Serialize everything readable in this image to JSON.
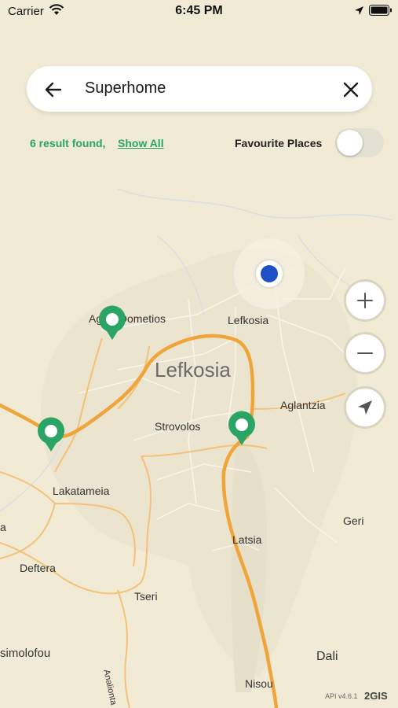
{
  "status_bar": {
    "carrier": "Carrier",
    "time": "6:45 PM"
  },
  "search": {
    "query": "Superhome"
  },
  "results": {
    "count_text": "6 result found,",
    "show_all_label": "Show All"
  },
  "favourites": {
    "label": "Favourite Places",
    "enabled": false
  },
  "map": {
    "labels": {
      "agios_dometios": "Agios Dometios",
      "lefkosia": "Lefkosia",
      "lefkosia_big": "Lefkosia",
      "aglantzia": "Aglantzia",
      "strovolos": "Strovolos",
      "lakatameia": "Lakatameia",
      "geri": "Geri",
      "latsia": "Latsia",
      "deftera": "Deftera",
      "tseri": "Tseri",
      "psimolofou": "simolofou",
      "analionta": "Analionta",
      "dali": "Dali",
      "nisou": "Nisou",
      "edge_a": "a"
    },
    "attribution": {
      "api_version": "API v4.6.1",
      "brand": "2GIS"
    }
  },
  "colors": {
    "accent": "#2aa566",
    "road": "#f0a43a",
    "location": "#1e4fc7",
    "land": "#f1ebd6"
  },
  "icons": [
    "back-arrow-icon",
    "close-icon",
    "plus-icon",
    "minus-icon",
    "navigation-arrow-icon",
    "map-pin-icon",
    "wifi-icon",
    "location-icon",
    "battery-icon"
  ]
}
